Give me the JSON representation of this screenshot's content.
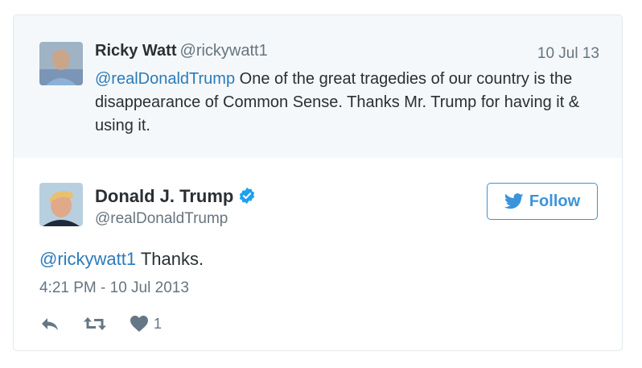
{
  "parent_tweet": {
    "author_name": "Ricky Watt",
    "author_handle": "@rickywatt1",
    "date": "10 Jul 13",
    "mention": "@realDonaldTrump",
    "text": " One of the great tragedies of our country is the disappearance of Common Sense. Thanks Mr. Trump for having it & using it."
  },
  "tweet": {
    "author_name": "Donald J. Trump",
    "author_handle": "@realDonaldTrump",
    "follow_label": "Follow",
    "mention": "@rickywatt1",
    "text": " Thanks.",
    "timestamp": "4:21 PM - 10 Jul 2013",
    "like_count": "1"
  },
  "colors": {
    "link": "#2b7bb9",
    "follow": "#3b94d9",
    "verified": "#1da1f2",
    "muted": "#66757f",
    "parent_bg": "#f5f8fa"
  },
  "icons": {
    "reply": "reply-icon",
    "retweet": "retweet-icon",
    "like": "heart-icon",
    "verified": "verified-badge-icon",
    "bird": "twitter-bird-icon"
  }
}
